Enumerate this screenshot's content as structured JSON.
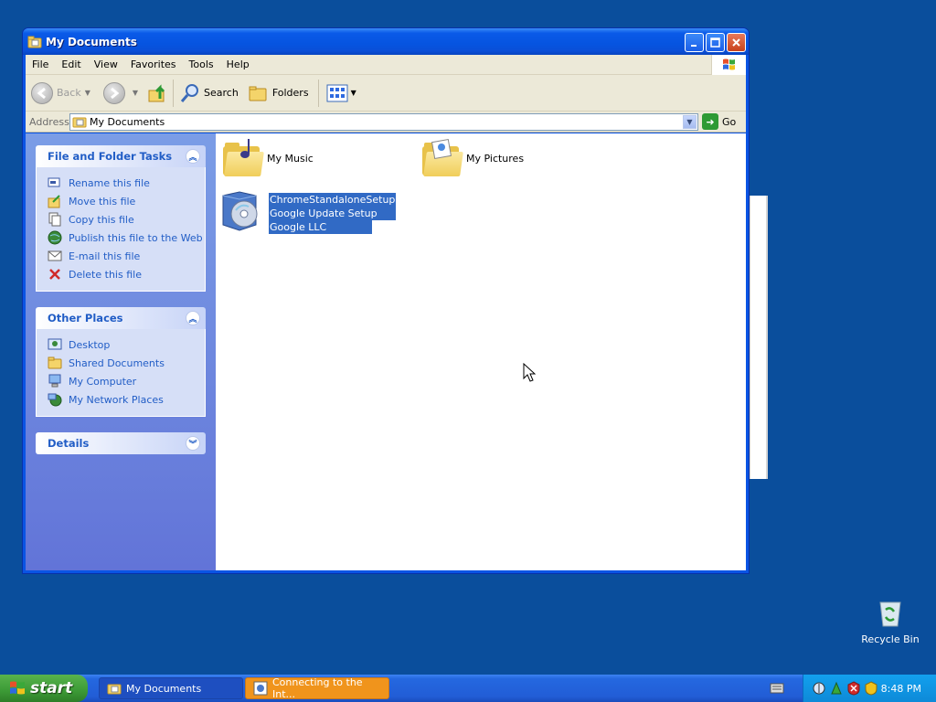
{
  "window": {
    "title": "My Documents",
    "controls": [
      "minimize",
      "maximize",
      "close"
    ]
  },
  "menubar": {
    "items": [
      "File",
      "Edit",
      "View",
      "Favorites",
      "Tools",
      "Help"
    ]
  },
  "toolbar": {
    "back_label": "Back",
    "search_label": "Search",
    "folders_label": "Folders"
  },
  "address": {
    "label": "Address",
    "value": "My Documents",
    "go_label": "Go"
  },
  "taskpane": {
    "file_tasks": {
      "title": "File and Folder Tasks",
      "items": [
        {
          "label": "Rename this file",
          "icon": "rename-icon"
        },
        {
          "label": "Move this file",
          "icon": "move-icon"
        },
        {
          "label": "Copy this file",
          "icon": "copy-icon"
        },
        {
          "label": "Publish this file to the Web",
          "icon": "globe-icon"
        },
        {
          "label": "E-mail this file",
          "icon": "email-icon"
        },
        {
          "label": "Delete this file",
          "icon": "delete-icon"
        }
      ]
    },
    "other_places": {
      "title": "Other Places",
      "items": [
        {
          "label": "Desktop",
          "icon": "desktop-icon"
        },
        {
          "label": "Shared Documents",
          "icon": "folder-icon"
        },
        {
          "label": "My Computer",
          "icon": "computer-icon"
        },
        {
          "label": "My Network Places",
          "icon": "network-icon"
        }
      ]
    },
    "details": {
      "title": "Details"
    }
  },
  "files": [
    {
      "name": "My Music",
      "type": "folder"
    },
    {
      "name": "My Pictures",
      "type": "folder"
    },
    {
      "name": "ChromeStandaloneSetup",
      "description": "Google Update Setup",
      "company": "Google LLC",
      "type": "installer",
      "selected": true
    }
  ],
  "taskbar": {
    "start_label": "start",
    "tasks": [
      {
        "label": "My Documents",
        "state": "active"
      },
      {
        "label": "Connecting to the Int...",
        "state": "flashing"
      }
    ],
    "clock": "8:48 PM"
  },
  "desktop": {
    "recycle_bin_label": "Recycle Bin"
  },
  "colors": {
    "desktop": "#0a4e9c",
    "titlebar": "#0654e0",
    "taskpane_link": "#215dc6",
    "selection": "#316ac5",
    "start": "#3c9a36"
  }
}
